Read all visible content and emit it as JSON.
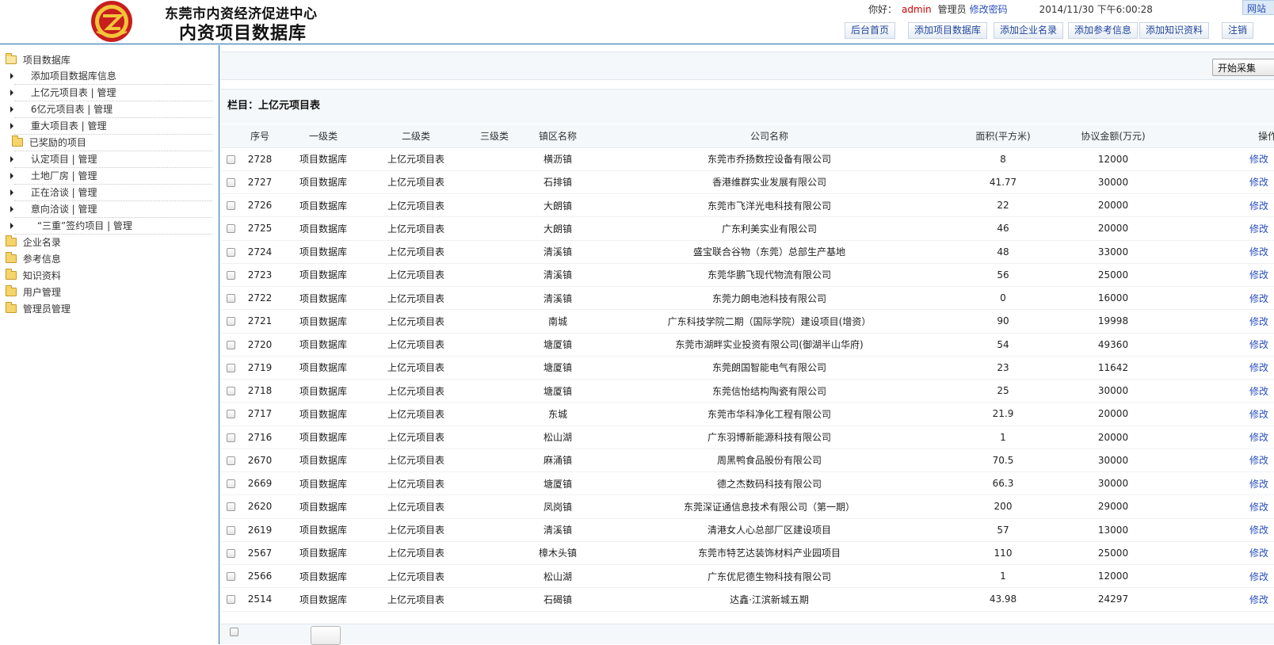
{
  "header": {
    "org_name": "东莞市内资经济促进中心",
    "db_title": "内资项目数据库",
    "greeting": "你好：",
    "username": "admin",
    "role": "管理员",
    "change_password": "修改密码",
    "datetime": "2014/11/30 下午6:00:28",
    "net_link": "网站",
    "nav": [
      "后台首页",
      "添加项目数据库",
      "添加企业名录",
      "添加参考信息",
      "添加知识资料",
      "注销"
    ]
  },
  "sidebar": {
    "root_project": "项目数据库",
    "add_project_info": "添加项目数据库信息",
    "items": [
      "上亿元项目表 | 管理",
      "6亿元项目表 | 管理",
      "重大项目表 | 管理"
    ],
    "rewarded": "已奖励的项目",
    "rewarded_items": [
      "认定项目 | 管理",
      "土地厂房 | 管理",
      "正在洽谈 | 管理",
      "意向洽谈 | 管理",
      "“三重”签约项目 | 管理"
    ],
    "roots": [
      "企业名录",
      "参考信息",
      "知识资料",
      "用户管理",
      "管理员管理"
    ]
  },
  "main": {
    "start_button": "开始采集",
    "section_title": "栏目：上亿元项目表",
    "columns": [
      "序号",
      "一级类",
      "二级类",
      "三级类",
      "镇区名称",
      "公司名称",
      "面积(平方米)",
      "协议金额(万元)",
      "操作"
    ],
    "edit_label": "修改",
    "rows": [
      {
        "id": "2728",
        "l1": "项目数据库",
        "l2": "上亿元项目表",
        "l3": "",
        "town": "横沥镇",
        "company": "东莞市乔扬数控设备有限公司",
        "area": "8",
        "amount": "12000"
      },
      {
        "id": "2727",
        "l1": "项目数据库",
        "l2": "上亿元项目表",
        "l3": "",
        "town": "石排镇",
        "company": "香港维群实业发展有限公司",
        "area": "41.77",
        "amount": "30000"
      },
      {
        "id": "2726",
        "l1": "项目数据库",
        "l2": "上亿元项目表",
        "l3": "",
        "town": "大朗镇",
        "company": "东莞市飞洋光电科技有限公司",
        "area": "22",
        "amount": "20000"
      },
      {
        "id": "2725",
        "l1": "项目数据库",
        "l2": "上亿元项目表",
        "l3": "",
        "town": "大朗镇",
        "company": "广东利美实业有限公司",
        "area": "46",
        "amount": "20000"
      },
      {
        "id": "2724",
        "l1": "项目数据库",
        "l2": "上亿元项目表",
        "l3": "",
        "town": "清溪镇",
        "company": "盛宝联合谷物（东莞）总部生产基地",
        "area": "48",
        "amount": "33000"
      },
      {
        "id": "2723",
        "l1": "项目数据库",
        "l2": "上亿元项目表",
        "l3": "",
        "town": "清溪镇",
        "company": "东莞华鹏飞现代物流有限公司",
        "area": "56",
        "amount": "25000"
      },
      {
        "id": "2722",
        "l1": "项目数据库",
        "l2": "上亿元项目表",
        "l3": "",
        "town": "清溪镇",
        "company": "东莞力朗电池科技有限公司",
        "area": "0",
        "amount": "16000"
      },
      {
        "id": "2721",
        "l1": "项目数据库",
        "l2": "上亿元项目表",
        "l3": "",
        "town": "南城",
        "company": "广东科技学院二期（国际学院）建设项目(增资）",
        "area": "90",
        "amount": "19998"
      },
      {
        "id": "2720",
        "l1": "项目数据库",
        "l2": "上亿元项目表",
        "l3": "",
        "town": "塘厦镇",
        "company": "东莞市湖畔实业投资有限公司(御湖半山华府)",
        "area": "54",
        "amount": "49360"
      },
      {
        "id": "2719",
        "l1": "项目数据库",
        "l2": "上亿元项目表",
        "l3": "",
        "town": "塘厦镇",
        "company": "东莞朗国智能电气有限公司",
        "area": "23",
        "amount": "11642"
      },
      {
        "id": "2718",
        "l1": "项目数据库",
        "l2": "上亿元项目表",
        "l3": "",
        "town": "塘厦镇",
        "company": "东莞信怡结构陶瓷有限公司",
        "area": "25",
        "amount": "30000"
      },
      {
        "id": "2717",
        "l1": "项目数据库",
        "l2": "上亿元项目表",
        "l3": "",
        "town": "东城",
        "company": "东莞市华科净化工程有限公司",
        "area": "21.9",
        "amount": "20000"
      },
      {
        "id": "2716",
        "l1": "项目数据库",
        "l2": "上亿元项目表",
        "l3": "",
        "town": "松山湖",
        "company": "广东羽博新能源科技有限公司",
        "area": "1",
        "amount": "20000"
      },
      {
        "id": "2670",
        "l1": "项目数据库",
        "l2": "上亿元项目表",
        "l3": "",
        "town": "麻涌镇",
        "company": "周黑鸭食品股份有限公司",
        "area": "70.5",
        "amount": "30000"
      },
      {
        "id": "2669",
        "l1": "项目数据库",
        "l2": "上亿元项目表",
        "l3": "",
        "town": "塘厦镇",
        "company": "德之杰数码科技有限公司",
        "area": "66.3",
        "amount": "30000"
      },
      {
        "id": "2620",
        "l1": "项目数据库",
        "l2": "上亿元项目表",
        "l3": "",
        "town": "凤岗镇",
        "company": "东莞深证通信息技术有限公司（第一期）",
        "area": "200",
        "amount": "29000"
      },
      {
        "id": "2619",
        "l1": "项目数据库",
        "l2": "上亿元项目表",
        "l3": "",
        "town": "清溪镇",
        "company": "清港女人心总部厂区建设项目",
        "area": "57",
        "amount": "13000"
      },
      {
        "id": "2567",
        "l1": "项目数据库",
        "l2": "上亿元项目表",
        "l3": "",
        "town": "樟木头镇",
        "company": "东莞市特艺达装饰材料产业园项目",
        "area": "110",
        "amount": "25000"
      },
      {
        "id": "2566",
        "l1": "项目数据库",
        "l2": "上亿元项目表",
        "l3": "",
        "town": "松山湖",
        "company": "广东优尼德生物科技有限公司",
        "area": "1",
        "amount": "12000"
      },
      {
        "id": "2514",
        "l1": "项目数据库",
        "l2": "上亿元项目表",
        "l3": "",
        "town": "石碣镇",
        "company": "达鑫·江滨新城五期",
        "area": "43.98",
        "amount": "24297"
      }
    ]
  },
  "colors": {
    "accent": "#1c6ea8",
    "link": "#2a4fbf",
    "username": "#cc0000",
    "panel_bg": "#f4f8fb"
  }
}
